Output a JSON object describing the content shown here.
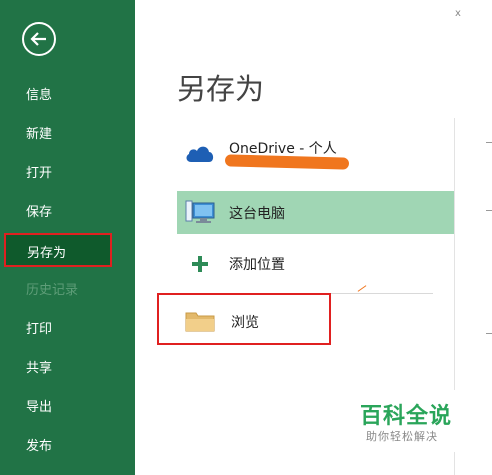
{
  "sidebar": {
    "items": [
      {
        "label": "信息"
      },
      {
        "label": "新建"
      },
      {
        "label": "打开"
      },
      {
        "label": "保存"
      },
      {
        "label": "另存为"
      },
      {
        "label": "历史记录"
      },
      {
        "label": "打印"
      },
      {
        "label": "共享"
      },
      {
        "label": "导出"
      },
      {
        "label": "发布"
      }
    ]
  },
  "main": {
    "title": "另存为",
    "options": [
      {
        "label": "OneDrive - 个人",
        "icon": "cloud-icon"
      },
      {
        "label": "这台电脑",
        "icon": "computer-icon"
      },
      {
        "label": "添加位置",
        "icon": "plus-icon"
      },
      {
        "label": "浏览",
        "icon": "folder-icon"
      }
    ]
  },
  "topright": "x",
  "watermark": {
    "title": "百科全说",
    "subtitle": "助你轻松解决"
  },
  "colors": {
    "sidebar": "#217346",
    "active": "#0f5a2c",
    "selected": "#a0d6b4",
    "highlight": "#e02020"
  }
}
